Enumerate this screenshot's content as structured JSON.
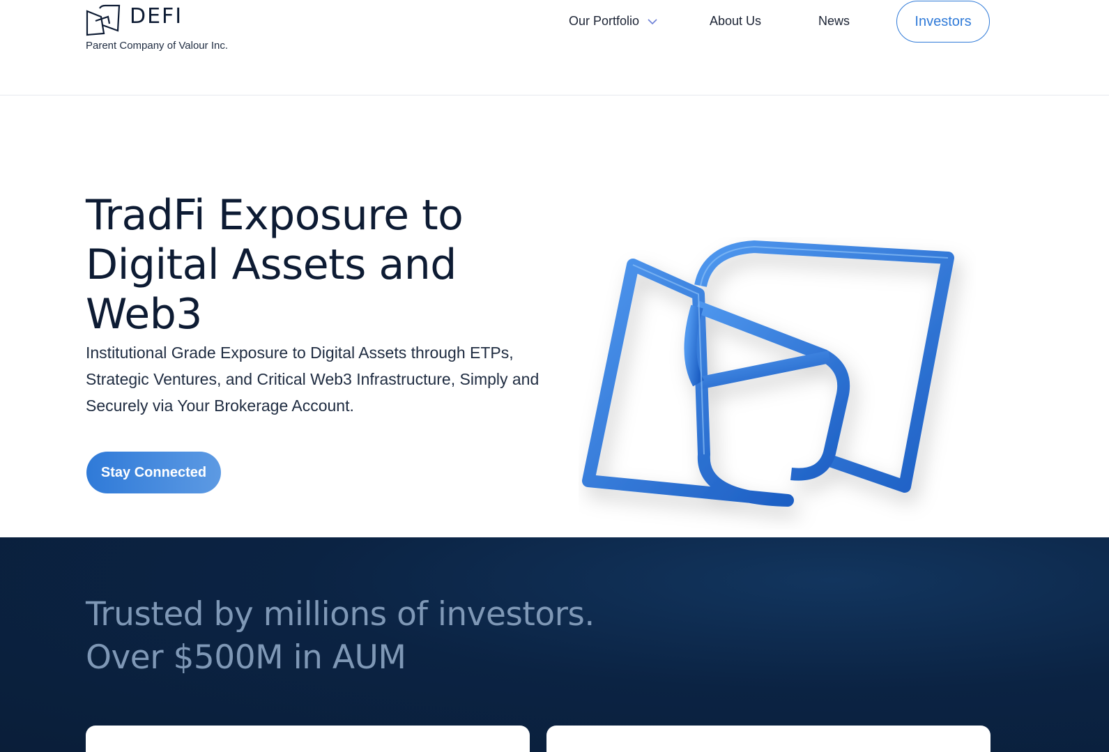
{
  "brand": {
    "name": "DEFI",
    "tagline": "Parent Company of Valour Inc.",
    "logo_icon": "defi-logo-icon"
  },
  "nav": {
    "portfolio_label": "Our Portfolio",
    "portfolio_icon": "chevron-down-icon",
    "about_label": "About Us",
    "news_label": "News",
    "investors_label": "Investors"
  },
  "hero": {
    "title": "TradFi Exposure to Digital Assets and Web3",
    "description": "Institutional Grade Exposure to Digital Assets through ETPs, Strategic Ventures, and Critical Web3 Infrastructure, Simply and Securely via Your Brokerage Account.",
    "cta_label": "Stay Connected",
    "art_icon": "defi-3d-logo-icon"
  },
  "trust": {
    "line1": "Trusted by millions of investors.",
    "line2": "Over $500M in AUM"
  },
  "colors": {
    "accent": "#2f7ad8",
    "navy": "#0d1b33",
    "dark_section": "#0b2343",
    "trust_text": "#7f98b6"
  }
}
